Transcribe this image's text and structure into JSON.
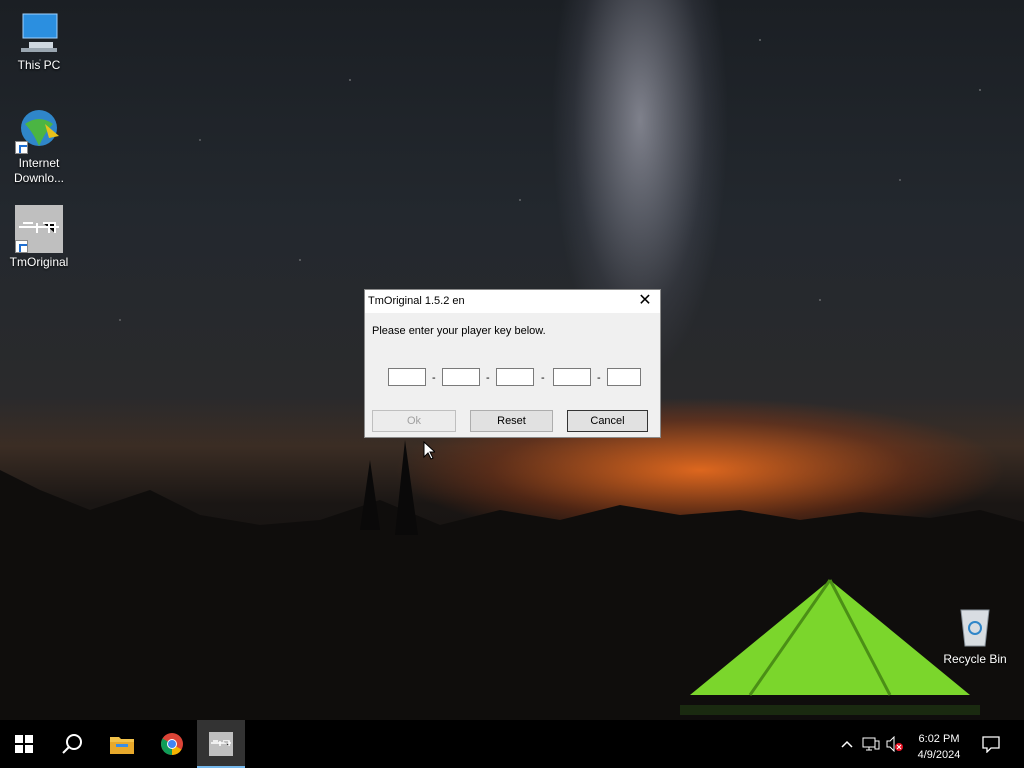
{
  "desktop": {
    "icons": [
      {
        "label": "This PC"
      },
      {
        "label": "Internet Downlo..."
      },
      {
        "label": "TmOriginal"
      },
      {
        "label": "Recycle Bin"
      }
    ]
  },
  "dialog": {
    "title": "TmOriginal 1.5.2 en",
    "prompt": "Please enter your player key below.",
    "key_fields": [
      "",
      "",
      "",
      "",
      ""
    ],
    "separator": "-",
    "buttons": {
      "ok": "Ok",
      "reset": "Reset",
      "cancel": "Cancel"
    },
    "close_glyph": "✕"
  },
  "taskbar": {
    "clock_time": "6:02 PM",
    "clock_date": "4/9/2024",
    "accent": "#76b9ed"
  }
}
